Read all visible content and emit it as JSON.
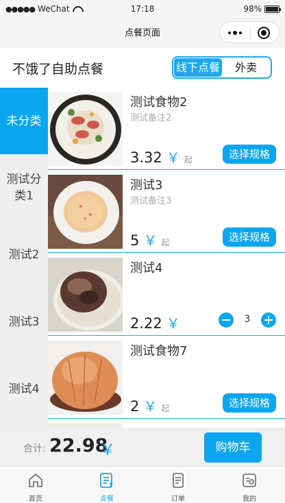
{
  "status_bar": {
    "carrier": "WeChat",
    "time": "17:18",
    "battery": "98%",
    "battery_level": 0.98
  },
  "nav": {
    "title": "点餐页面"
  },
  "shop": {
    "name": "不饿了自助点餐",
    "modes": [
      "线下点餐",
      "外卖"
    ],
    "active_mode": 0
  },
  "categories": [
    "未分类",
    "测试分类1",
    "测试2",
    "测试3",
    "测试4"
  ],
  "products": [
    {
      "name": "测试食物2",
      "note": "测试备注2",
      "price": "3.32",
      "currency": "￥",
      "suffix": "起",
      "action": "选择规格"
    },
    {
      "name": "测试3",
      "note": "测试备注3",
      "price": "5",
      "currency": "￥",
      "suffix": "起",
      "action": "选择规格"
    },
    {
      "name": "测试4",
      "note": "",
      "price": "2.22",
      "currency": "￥",
      "quantity": "3"
    },
    {
      "name": "测试食物7",
      "note": "",
      "price": "2",
      "currency": "￥",
      "suffix": "起",
      "action": "选择规格"
    }
  ],
  "summary": {
    "label": "合计:",
    "total": "22.98",
    "currency": "￥",
    "cart_label": "购物车"
  },
  "tabs": [
    "首页",
    "点餐",
    "订单",
    "我的"
  ],
  "colors": {
    "accent": "#0aa6f0",
    "divider": "#29a9e6"
  }
}
